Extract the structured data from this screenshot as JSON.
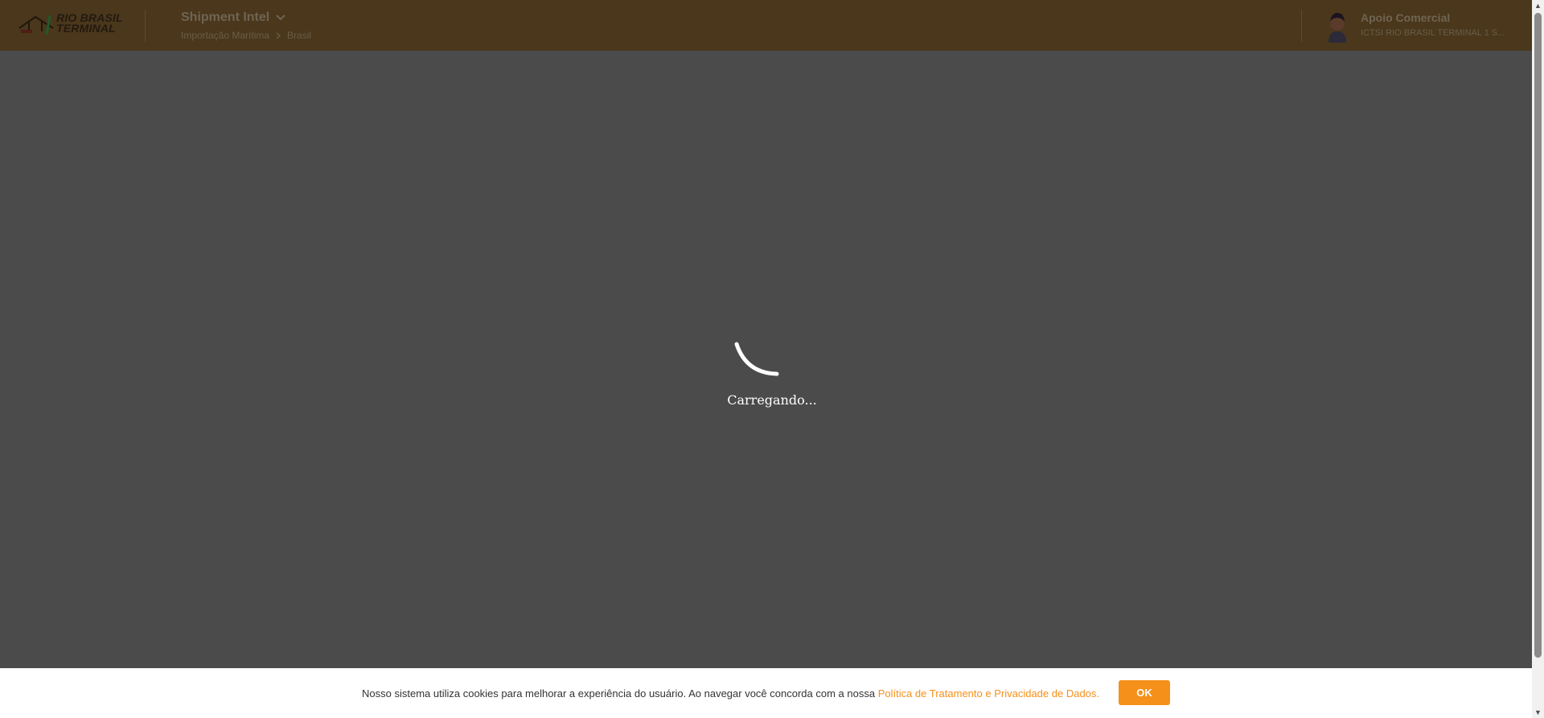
{
  "brand": {
    "logo_text": "RIO BRASIL TERMINAL",
    "logo_line1": "RIO BRASIL",
    "logo_line2": "TERMINAL"
  },
  "header": {
    "module_title": "Shipment Intel",
    "breadcrumb": [
      "Importação Marítima",
      "Brasil"
    ]
  },
  "user": {
    "name": "Apoio Comercial",
    "organization": "ICTSI RIO BRASIL TERMINAL 1 S..."
  },
  "loading": {
    "text": "Carregando..."
  },
  "cookie_banner": {
    "text": "Nosso sistema utiliza cookies para melhorar a experiência do usuário. Ao navegar você concorda com a nossa",
    "link_text": "Política de Tratamento e Privacidade de Dados.",
    "ok_label": "OK"
  },
  "colors": {
    "header_bg": "#4a371c",
    "overlay": "#4b4b4b",
    "accent": "#f5901a"
  }
}
